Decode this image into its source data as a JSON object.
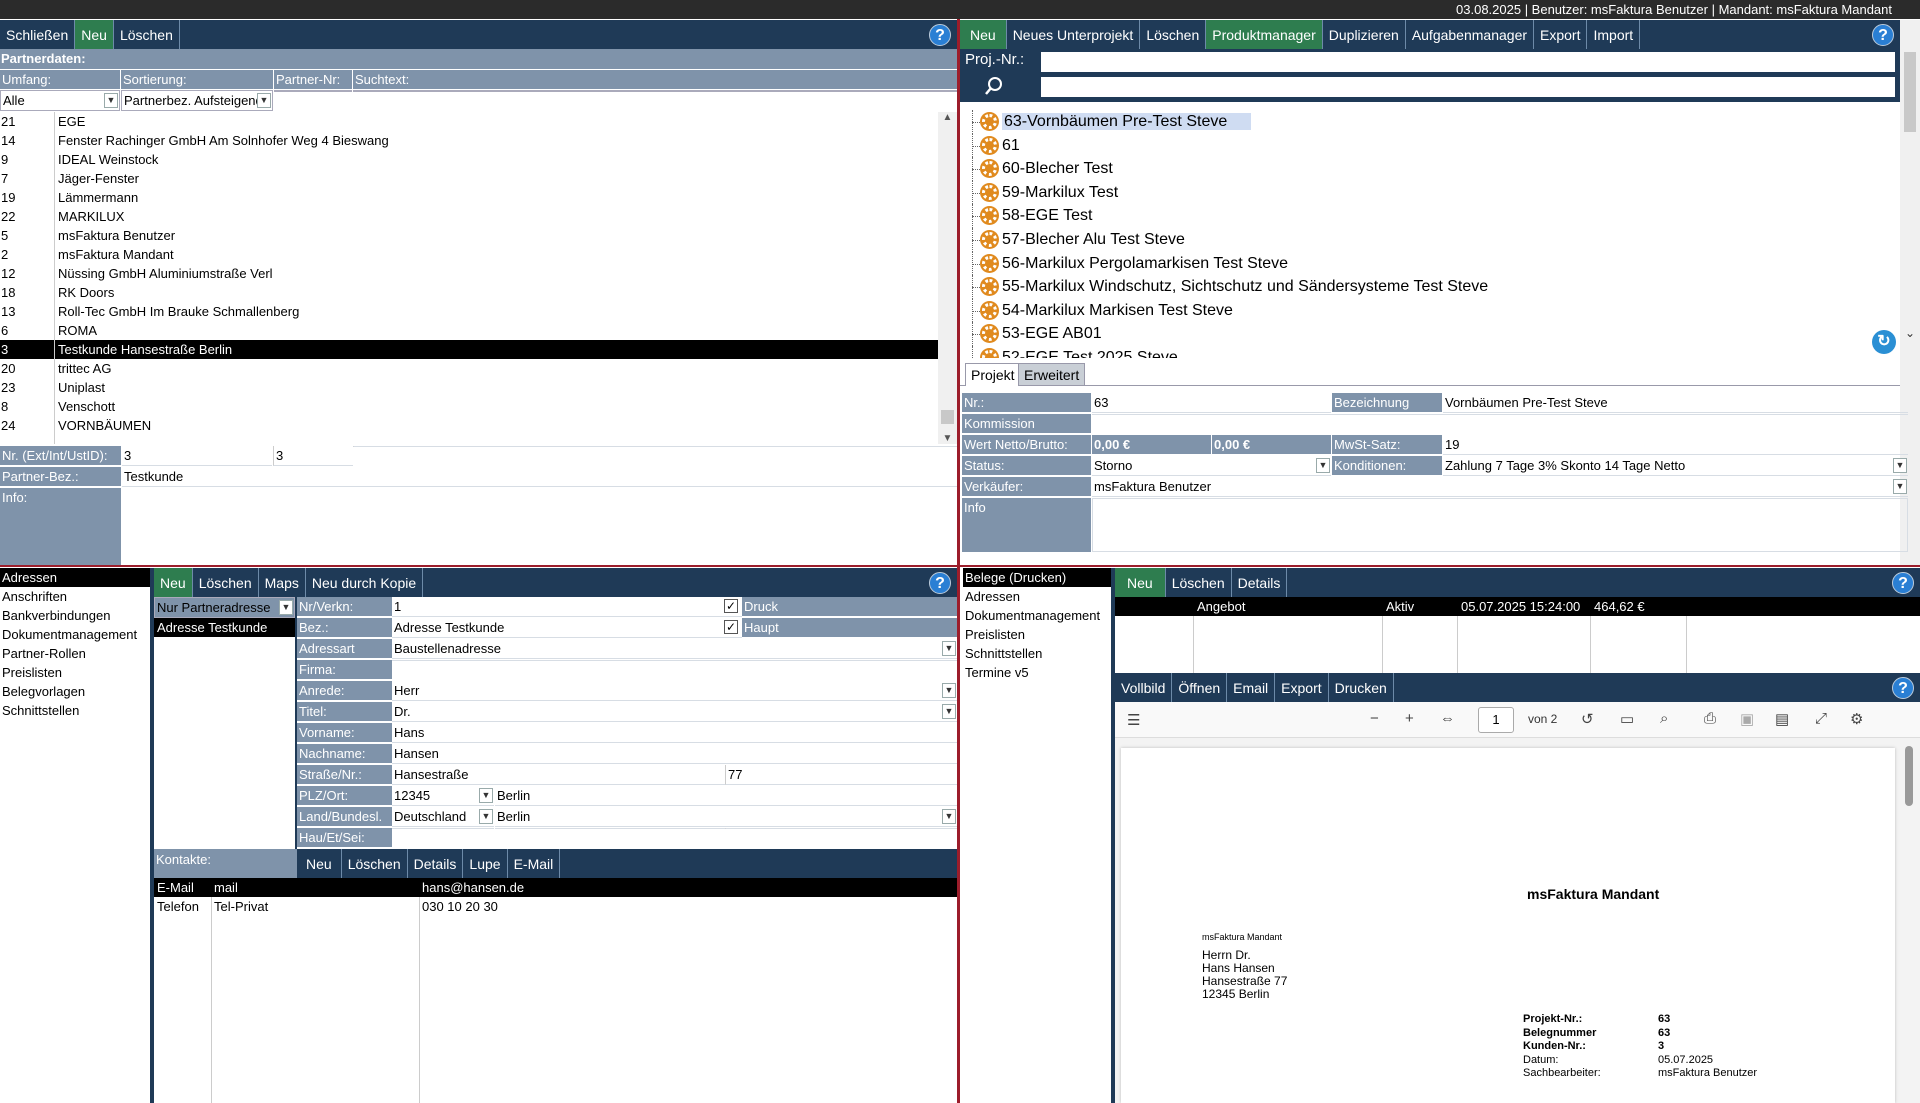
{
  "topbar": {
    "status": "03.08.2025 | Benutzer: msFaktura Benutzer | Mandant: msFaktura Mandant"
  },
  "partner_toolbar": {
    "close": "Schließen",
    "new": "Neu",
    "delete": "Löschen"
  },
  "partner": {
    "section_title": "Partnerdaten:",
    "filter_labels": {
      "scope": "Umfang:",
      "sort": "Sortierung:",
      "partner_no": "Partner-Nr:",
      "search": "Suchtext:"
    },
    "filter_values": {
      "scope": "Alle",
      "sort": "Partnerbez. Aufsteigend",
      "partner_no": "",
      "search": ""
    },
    "list": [
      {
        "no": "21",
        "name": "EGE"
      },
      {
        "no": "14",
        "name": "Fenster Rachinger GmbH Am Solnhofer Weg 4 Bieswang"
      },
      {
        "no": "9",
        "name": "IDEAL Weinstock"
      },
      {
        "no": "7",
        "name": "Jäger-Fenster"
      },
      {
        "no": "19",
        "name": "Lämmermann"
      },
      {
        "no": "22",
        "name": "MARKILUX"
      },
      {
        "no": "5",
        "name": "msFaktura Benutzer"
      },
      {
        "no": "2",
        "name": "msFaktura Mandant"
      },
      {
        "no": "12",
        "name": "Nüssing GmbH Aluminiumstraße Verl"
      },
      {
        "no": "18",
        "name": "RK Doors"
      },
      {
        "no": "13",
        "name": "Roll-Tec GmbH Im Brauke Schmallenberg"
      },
      {
        "no": "6",
        "name": "ROMA"
      },
      {
        "no": "3",
        "name": "Testkunde Hansestraße Berlin"
      },
      {
        "no": "20",
        "name": "trittec AG"
      },
      {
        "no": "23",
        "name": "Uniplast"
      },
      {
        "no": "8",
        "name": "Venschott"
      },
      {
        "no": "24",
        "name": "VORNBÄUMEN"
      }
    ],
    "selected_index": 12,
    "ext_label": "Nr. (Ext/Int/UstID):",
    "ext_val1": "3",
    "ext_val2": "3",
    "ext_val3": "",
    "bez_label": "Partner-Bez.:",
    "bez_val": "Testkunde",
    "info_label": "Info:",
    "info_val": ""
  },
  "left_nav": {
    "items": [
      "Adressen",
      "Anschriften",
      "Bankverbindungen",
      "Dokumentmanagement",
      "Partner-Rollen",
      "Preislisten",
      "Belegvorlagen",
      "Schnittstellen"
    ]
  },
  "address_toolbar": {
    "new": "Neu",
    "delete": "Löschen",
    "maps": "Maps",
    "copy": "Neu durch Kopie"
  },
  "address": {
    "filter": "Nur Partneradresse",
    "list": [
      "Adresse Testkunde"
    ],
    "fields": {
      "nr_label": "Nr/Verkn:",
      "nr_val": "1",
      "druck_label": "Druck",
      "bez_label": "Bez.:",
      "bez_val": "Adresse Testkunde",
      "haupt_label": "Haupt",
      "art_label": "Adressart",
      "art_val": "Baustellenadresse",
      "firma_label": "Firma:",
      "firma_val": "",
      "anrede_label": "Anrede:",
      "anrede_val": "Herr",
      "titel_label": "Titel:",
      "titel_val": "Dr.",
      "vorname_label": "Vorname:",
      "vorname_val": "Hans",
      "nachname_label": "Nachname:",
      "nachname_val": "Hansen",
      "strasse_label": "Straße/Nr.:",
      "strasse_val": "Hansestraße",
      "hausnr_val": "77",
      "plz_label": "PLZ/Ort:",
      "plz_val": "12345",
      "ort_val": "Berlin",
      "land_label": "Land/Bundesl.",
      "land_val": "Deutschland",
      "bundesland_val": "Berlin",
      "hau_label": "Hau/Et/Sei:",
      "hau_val": "",
      "et_val": "",
      "sei_val": ""
    },
    "contacts_label": "Kontakte:",
    "contacts_toolbar": {
      "new": "Neu",
      "delete": "Löschen",
      "details": "Details",
      "lupe": "Lupe",
      "email": "E-Mail"
    },
    "contacts": [
      {
        "type": "E-Mail",
        "sub": "mail",
        "value": "hans@hansen.de"
      },
      {
        "type": "Telefon",
        "sub": "Tel-Privat",
        "value": "030 10 20 30"
      }
    ]
  },
  "project_toolbar": {
    "new": "Neu",
    "new_sub": "Neues Unterprojekt",
    "delete": "Löschen",
    "pm": "Produktmanager",
    "dup": "Duplizieren",
    "tasks": "Aufgabenmanager",
    "export": "Export",
    "import": "Import"
  },
  "project": {
    "proj_no_label": "Proj.-Nr.:",
    "proj_no_val": "",
    "search_val": "",
    "tree": [
      "63-Vornbäumen Pre-Test Steve",
      "61",
      "60-Blecher Test",
      "59-Markilux Test",
      "58-EGE Test",
      "57-Blecher Alu Test Steve",
      "56-Markilux Pergolamarkisen Test Steve",
      "55-Markilux Windschutz, Sichtschutz und Sändersysteme Test Steve",
      "54-Markilux Markisen Test Steve",
      "53-EGE AB01",
      "52-EGE Test 2025 Steve"
    ],
    "tabs": [
      "Projekt",
      "Erweitert"
    ],
    "detail": {
      "nr_label": "Nr.:",
      "nr_val": "63",
      "bez_label": "Bezeichnung",
      "bez_val": "Vornbäumen Pre-Test Steve",
      "kommission_label": "Kommission",
      "kommission_val": "",
      "wert_label": "Wert Netto/Brutto:",
      "netto": "0,00 €",
      "brutto": "0,00 €",
      "mwst_label": "MwSt-Satz:",
      "mwst_val": "19",
      "status_label": "Status:",
      "status_val": "Storno",
      "kond_label": "Konditionen:",
      "kond_val": "Zahlung 7 Tage 3% Skonto 14 Tage Netto",
      "verk_label": "Verkäufer:",
      "verk_val": "msFaktura Benutzer",
      "info_label": "Info",
      "info_val": ""
    }
  },
  "right_nav": {
    "items": [
      "Belege (Drucken)",
      "Adressen",
      "Dokumentmanagement",
      "Preislisten",
      "Schnittstellen",
      "Termine v5"
    ]
  },
  "beleg_toolbar": {
    "new": "Neu",
    "delete": "Löschen",
    "details": "Details"
  },
  "belege": [
    {
      "type": "Angebot",
      "status": "Aktiv",
      "date": "05.07.2025 15:24:00",
      "amount": "464,62 €"
    }
  ],
  "pdf_toolbar": {
    "full": "Vollbild",
    "open": "Öffnen",
    "email": "Email",
    "export": "Export",
    "print": "Drucken"
  },
  "pdf": {
    "page": "1",
    "of": "von 2",
    "title": "msFaktura Mandant",
    "sender": "msFaktura Mandant",
    "addr": [
      "Herrn Dr.",
      "Hans Hansen",
      "Hansestraße 77",
      "12345 Berlin"
    ],
    "meta": [
      {
        "k": "Projekt-Nr.:",
        "v": "63"
      },
      {
        "k": "Belegnummer",
        "v": "63"
      },
      {
        "k": "Kunden-Nr.:",
        "v": "3"
      },
      {
        "k": "Datum:",
        "v": "05.07.2025"
      },
      {
        "k": "Sachbearbeiter:",
        "v": "msFaktura Benutzer"
      }
    ]
  },
  "colors": {
    "toolbar": "#1f3a57",
    "green": "#2e7d4f",
    "label": "#7f93aa",
    "divider": "#9c1d2b"
  }
}
